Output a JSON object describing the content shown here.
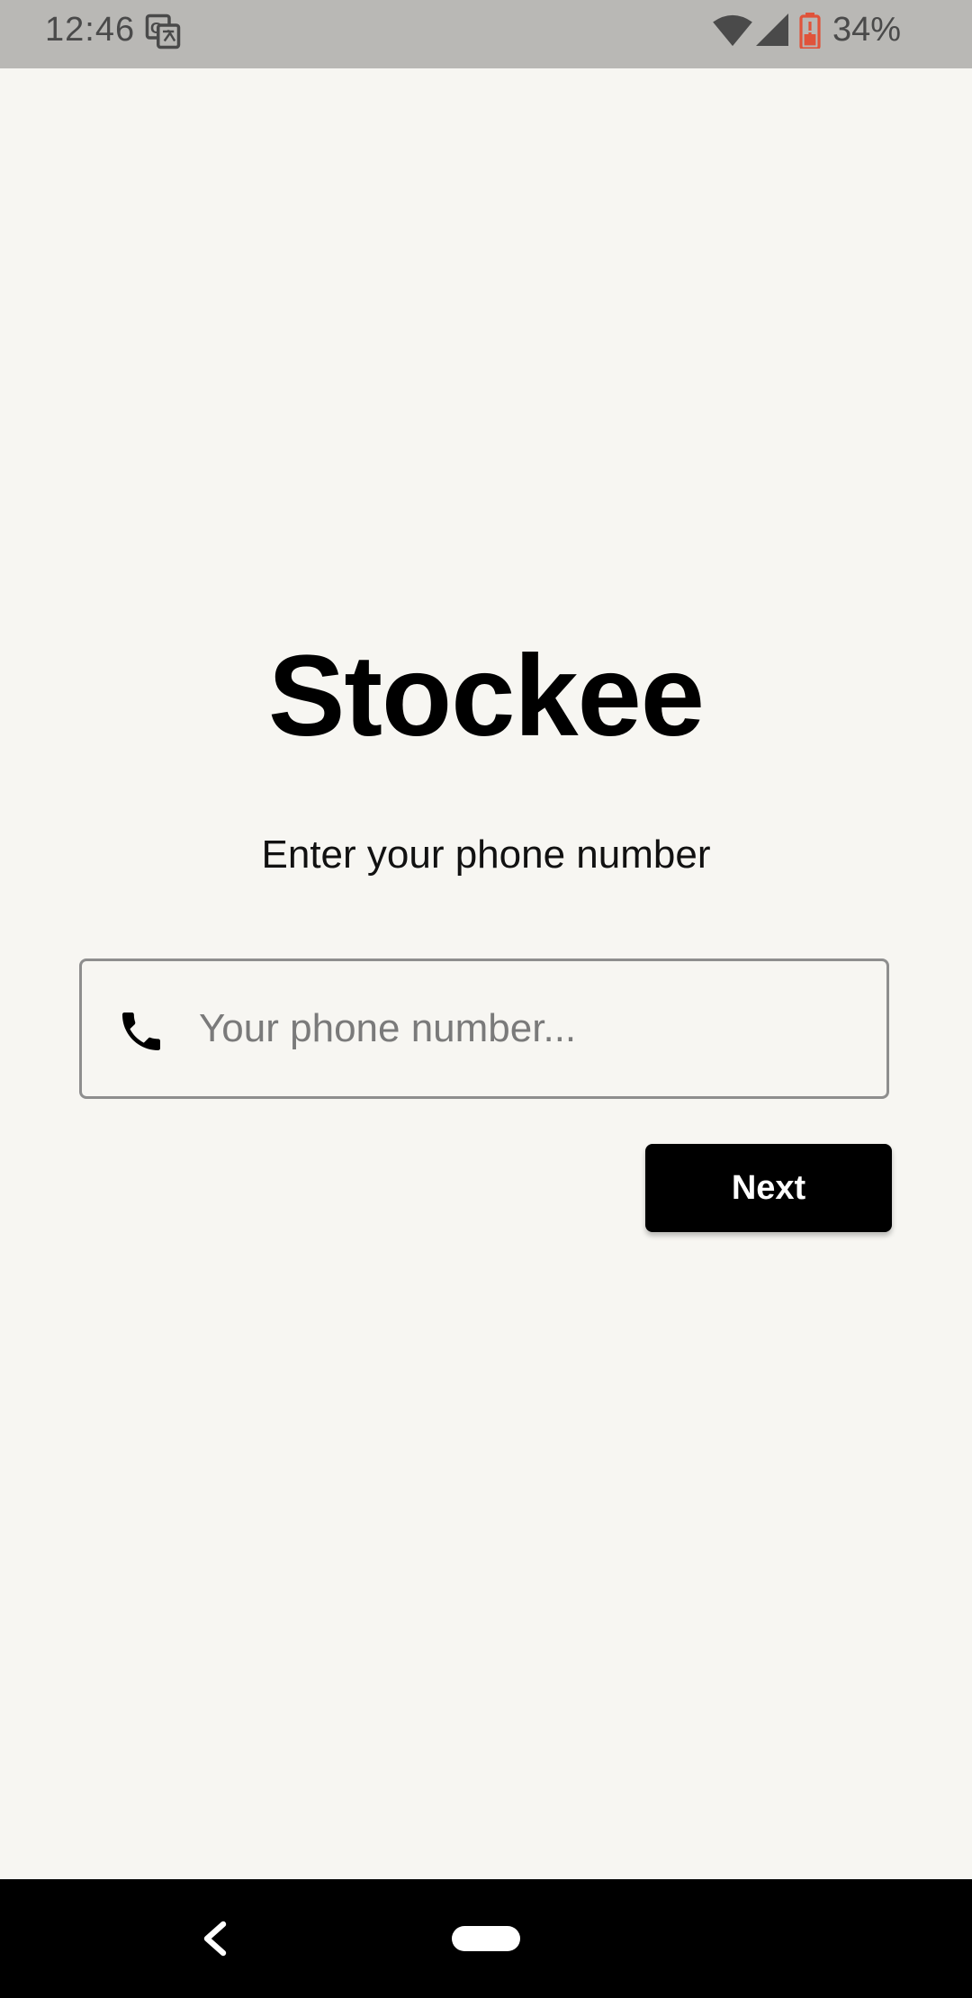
{
  "status_bar": {
    "time": "12:46",
    "battery_percent": "34%",
    "icons": [
      "translate-icon",
      "wifi-icon",
      "signal-icon",
      "battery-icon"
    ]
  },
  "app": {
    "title": "Stockee",
    "subtitle": "Enter your phone number"
  },
  "phone_field": {
    "icon": "phone-icon",
    "value": "",
    "placeholder": "Your phone number..."
  },
  "actions": {
    "next_label": "Next"
  },
  "nav_bar": {
    "icons": [
      "back-icon",
      "home-pill"
    ]
  },
  "colors": {
    "background": "#f7f6f2",
    "status_bar": "#b9b8b5",
    "button": "#000000",
    "button_text": "#ffffff",
    "battery_low": "#e0533a"
  }
}
